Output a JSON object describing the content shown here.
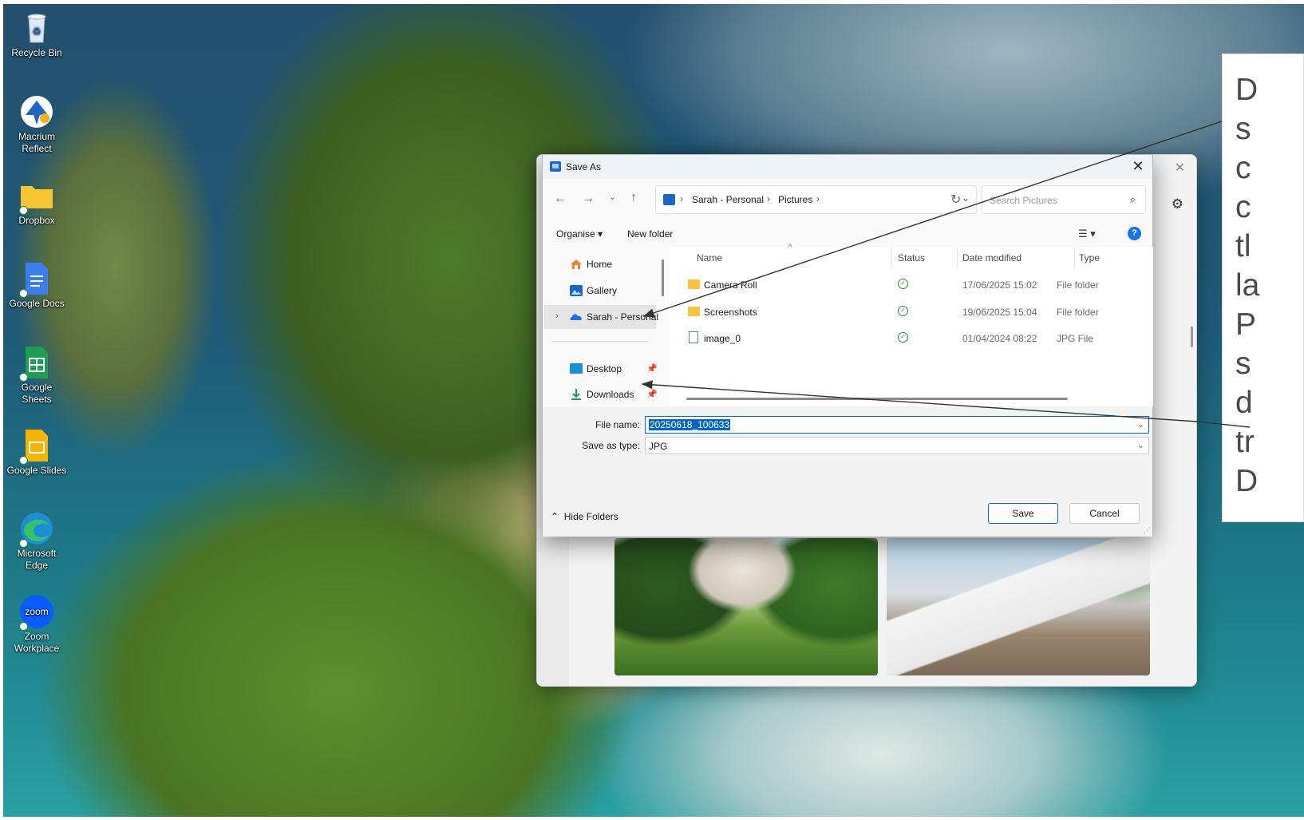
{
  "desktop": {
    "icons": [
      {
        "label": "Recycle Bin",
        "icon": "recycle-bin-icon"
      },
      {
        "label": "Macrium Reflect",
        "icon": "macrium-reflect-icon"
      },
      {
        "label": "Dropbox",
        "icon": "dropbox-folder-icon"
      },
      {
        "label": "Google Docs",
        "icon": "google-docs-icon"
      },
      {
        "label": "Google Sheets",
        "icon": "google-sheets-icon"
      },
      {
        "label": "Google Slides",
        "icon": "google-slides-icon"
      },
      {
        "label": "Microsoft Edge",
        "icon": "edge-icon"
      },
      {
        "label": "Zoom Workplace",
        "icon": "zoom-icon"
      }
    ]
  },
  "callout": {
    "lines": [
      "D",
      "s",
      "c",
      "c",
      "tl",
      "la",
      "P",
      "s",
      "d",
      "tr",
      "D"
    ]
  },
  "dialog": {
    "title": "Save As",
    "address": {
      "crumbs": [
        "Sarah - Personal",
        "Pictures"
      ],
      "separator": "›"
    },
    "search_placeholder": "Search Pictures",
    "commands": {
      "organise": "Organise ▾",
      "new_folder": "New folder"
    },
    "nav_pane": [
      {
        "label": "Home",
        "icon": "home-icon"
      },
      {
        "label": "Gallery",
        "icon": "gallery-icon"
      },
      {
        "label": "Sarah - Personal",
        "icon": "onedrive-icon",
        "selected": true
      },
      {
        "label": "Desktop",
        "icon": "desktop-icon",
        "pinned": true
      },
      {
        "label": "Downloads",
        "icon": "downloads-icon",
        "pinned": true
      }
    ],
    "columns": [
      "Name",
      "Status",
      "Date modified",
      "Type"
    ],
    "files": [
      {
        "name": "Camera Roll",
        "status": "synced",
        "date": "17/06/2025 15:02",
        "type": "File folder",
        "kind": "folder"
      },
      {
        "name": "Screenshots",
        "status": "synced",
        "date": "19/06/2025 15:04",
        "type": "File folder",
        "kind": "folder"
      },
      {
        "name": "image_0",
        "status": "synced",
        "date": "01/04/2024 08:22",
        "type": "JPG File",
        "kind": "jpg"
      }
    ],
    "file_name_label": "File name:",
    "file_name_value": "20250618_100633",
    "save_type_label": "Save as type:",
    "save_type_value": "JPG",
    "hide_folders": "Hide Folders",
    "save_button": "Save",
    "cancel_button": "Cancel"
  },
  "colors": {
    "accent": "#0067c0",
    "help": "#1a73e8",
    "folder": "#f6c343",
    "synced": "#2e8b3e"
  }
}
